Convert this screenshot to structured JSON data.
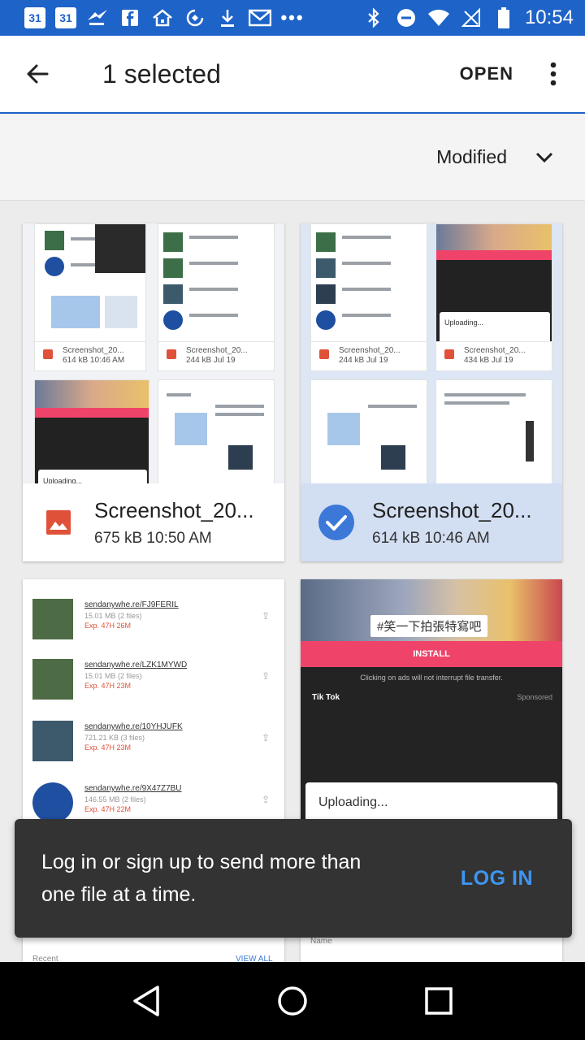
{
  "status_bar": {
    "time": "10:54",
    "calendar_1": "31",
    "calendar_2": "31",
    "dots": "•••",
    "icons": [
      "calendar-icon",
      "calendar-icon",
      "sendanywhere-icon",
      "facebook-icon",
      "home-icon",
      "sync-icon",
      "download-icon",
      "gmail-icon",
      "bluetooth-icon",
      "do-not-disturb-icon",
      "wifi-icon",
      "no-signal-icon",
      "battery-icon"
    ]
  },
  "app_bar": {
    "title": "1 selected",
    "open_label": "OPEN"
  },
  "sort": {
    "label": "Modified"
  },
  "files": [
    {
      "name": "Screenshot_20...",
      "meta": "675 kB 10:50 AM",
      "selected": false,
      "thumb_captions": [
        {
          "name": "Screenshot_20...",
          "meta": "614 kB 10:46 AM"
        },
        {
          "name": "Screenshot_20...",
          "meta": "244 kB Jul 19"
        }
      ],
      "thumb_uploading": "Uploading..."
    },
    {
      "name": "Screenshot_20...",
      "meta": "614 kB 10:46 AM",
      "selected": true,
      "thumb_captions": [
        {
          "name": "Screenshot_20...",
          "meta": "244 kB Jul 19"
        },
        {
          "name": "Screenshot_20...",
          "meta": "434 kB Jul 19"
        }
      ],
      "thumb_uploading": "Uploading..."
    }
  ],
  "bottom_left_thumb": {
    "rows": [
      {
        "link": "sendanywhe.re/FJ9FERIL",
        "sub": "15.01 MB (2 files)",
        "exp": "Exp. 47H 26M"
      },
      {
        "link": "sendanywhe.re/LZK1MYWD",
        "sub": "15.01 MB (2 files)",
        "exp": "Exp. 47H 23M"
      },
      {
        "link": "sendanywhe.re/10YHJUFK",
        "sub": "721.21 KB (3 files)",
        "exp": "Exp. 47H 23M"
      },
      {
        "link": "sendanywhe.re/9X47Z7BU",
        "sub": "146.55 MB (2 files)",
        "exp": "Exp. 47H 22M"
      }
    ],
    "recent_label": "Recent",
    "view_all_label": "VIEW ALL"
  },
  "bottom_right_thumb": {
    "banner": "#笑一下拍張特寫吧",
    "install": "INSTALL",
    "note": "Clicking on ads will not interrupt file transfer.",
    "app_name": "Tik Tok",
    "sponsored": "Sponsored",
    "uploading": "Uploading...",
    "name_sort": "Name"
  },
  "snackbar": {
    "message": "Log in or sign up to send more than one file at a time.",
    "action": "LOG IN",
    "action_color": "#3d97f2"
  },
  "colors": {
    "status_bar": "#1e63c8",
    "selected_card": "#d2def2",
    "check": "#3b78d8",
    "image_icon": "#e0513a"
  }
}
